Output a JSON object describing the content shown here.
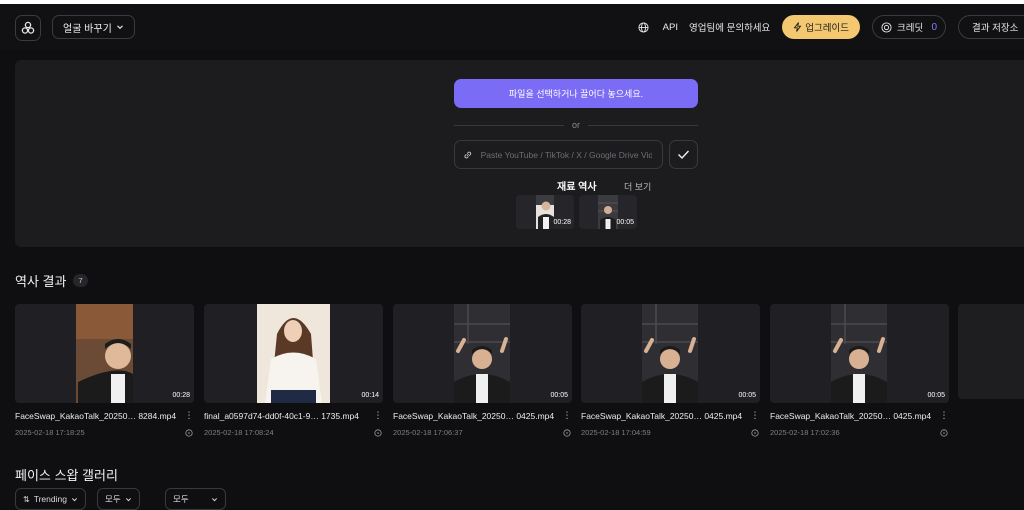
{
  "header": {
    "lang_switch": "얼굴 바꾸기",
    "api": "API",
    "contact_sales": "영업팀에 문의하세요",
    "upgrade": "업그레이드",
    "credit_label": "크레딧",
    "credit_count": "0",
    "save_results": "결과 저장소"
  },
  "upload": {
    "pick_file": "파일을 선택하거나 끌어다 놓으세요.",
    "or": "or",
    "url_placeholder": "Paste YouTube / TikTok / X / Google Drive Video",
    "material_history_title": "재료 역사",
    "more": "더 보기",
    "materials": [
      {
        "duration": "00:28"
      },
      {
        "duration": "00:05"
      }
    ]
  },
  "history": {
    "title": "역사 결과",
    "count": "7",
    "items": [
      {
        "name": "FaceSwap_KakaoTalk_20250… 8284.mp4",
        "date": "2025-02-18 17:18:25",
        "duration": "00:28"
      },
      {
        "name": "final_a0597d74-dd0f-40c1-9… 1735.mp4",
        "date": "2025-02-18 17:08:24",
        "duration": "00:14"
      },
      {
        "name": "FaceSwap_KakaoTalk_20250… 0425.mp4",
        "date": "2025-02-18 17:06:37",
        "duration": "00:05"
      },
      {
        "name": "FaceSwap_KakaoTalk_20250… 0425.mp4",
        "date": "2025-02-18 17:04:59",
        "duration": "00:05"
      },
      {
        "name": "FaceSwap_KakaoTalk_20250… 0425.mp4",
        "date": "2025-02-18 17:02:36",
        "duration": "00:05"
      }
    ]
  },
  "gallery": {
    "title": "페이스 스왑 갤러리",
    "filters": [
      "Trending",
      "모두",
      "모두"
    ]
  },
  "colors": {
    "accent": "#7b6cf6",
    "upgrade": "#f4c871",
    "credit_count": "#7f7cff"
  }
}
